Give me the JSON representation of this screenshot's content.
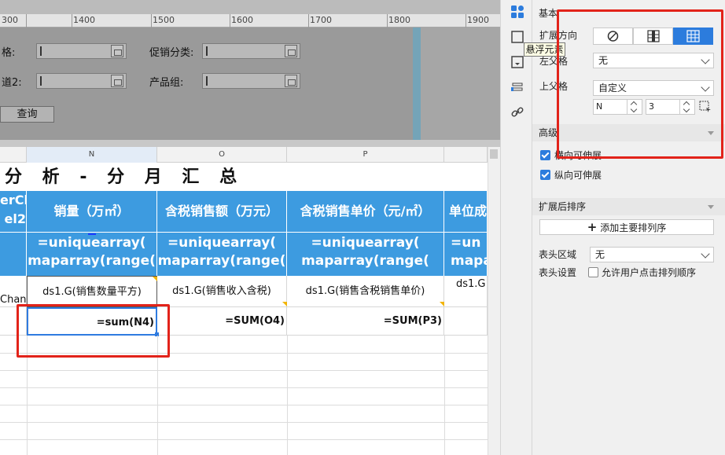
{
  "ruler": {
    "ticks": [
      "300",
      "1400",
      "1500",
      "1600",
      "1700",
      "1800",
      "1900"
    ]
  },
  "params": [
    {
      "label": "格:"
    },
    {
      "label": "促销分类:"
    },
    {
      "label": "道2:"
    },
    {
      "label": "产品组:"
    }
  ],
  "query_button": "查询",
  "sheet": {
    "columns": [
      "N",
      "O",
      "P"
    ],
    "title": "分 析 - 分 月 汇 总",
    "headers": [
      "erCh\nel2",
      "销量（万㎡）",
      "含税销售额（万元）",
      "含税销售单价（元/㎡）",
      "单位成"
    ],
    "formula_lines": [
      [
        "=uniquearray(",
        "maparray(range("
      ],
      [
        "=uniquearray(",
        "maparray(range("
      ],
      [
        "=uniquearray(",
        "maparray(range("
      ],
      [
        "=un",
        "mapa"
      ]
    ],
    "left_stub": "Chan",
    "data_row": [
      "ds1.G(销售数量平方)",
      "ds1.G(销售收入含税)",
      "ds1.G(销售含税销售单价)",
      "ds1.G"
    ],
    "sum_row": [
      "=sum(N4)",
      "=SUM(O4)",
      "=SUM(P3)"
    ]
  },
  "tooltip": "悬浮元素",
  "panel": {
    "basic_section": "基本",
    "expand_direction_label": "扩展方向",
    "left_parent_label": "左父格",
    "left_parent_value": "无",
    "top_parent_label": "上父格",
    "top_parent_value": "自定义",
    "top_parent_col": "N",
    "top_parent_row": "3",
    "advanced_section": "高级",
    "horizontal_extend": "横向可伸展",
    "vertical_extend": "纵向可伸展",
    "sort_section": "扩展后排序",
    "add_sort_button": "添加主要排列序",
    "header_area_label": "表头区域",
    "header_area_value": "无",
    "header_setting_label": "表头设置",
    "allow_user_sort": "允许用户点击排列顺序"
  },
  "colors": {
    "header_blue": "#3d9be0",
    "accent_blue": "#2c7cdd",
    "annotation_red": "#e2231a"
  },
  "icons": [
    "cell-attributes-icon",
    "cell-element-icon",
    "float-element-icon",
    "condition-attributes-icon",
    "hyperlink-icon",
    "ban-icon",
    "column-expand-icon",
    "grid-expand-icon",
    "select-cell-icon",
    "plus-icon",
    "collapse-triangle-icon"
  ]
}
